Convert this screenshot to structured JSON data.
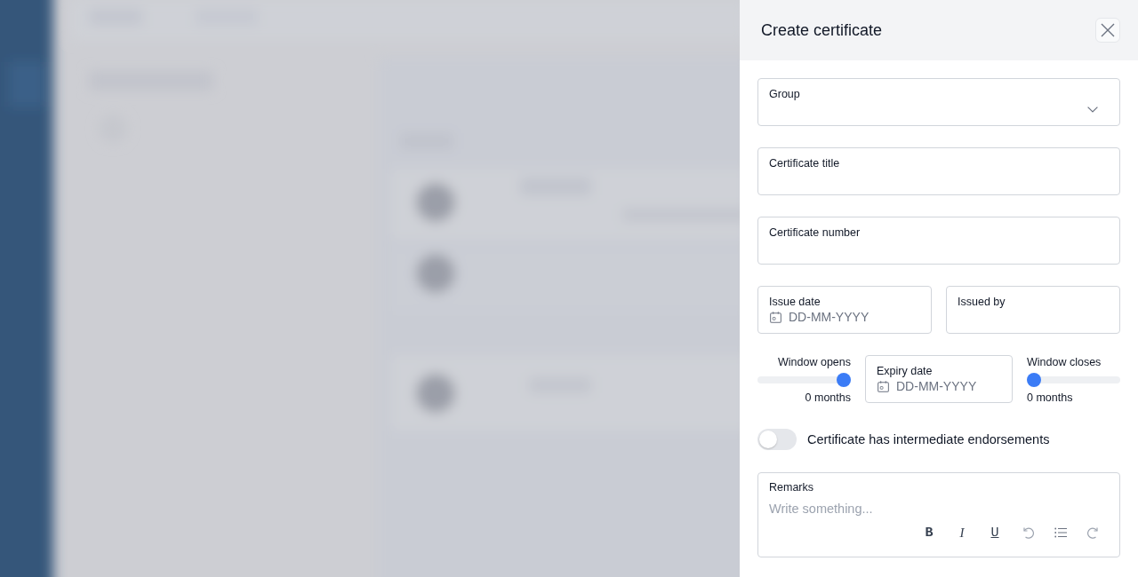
{
  "drawer": {
    "title": "Create certificate"
  },
  "fields": [
    {
      "kind": "select",
      "label": "Group"
    },
    {
      "kind": "text",
      "label": "Certificate title"
    },
    {
      "kind": "text",
      "label": "Certificate number"
    }
  ],
  "issue_row": [
    {
      "kind": "date",
      "label": "Issue date",
      "placeholder": "DD-MM-YYYY"
    },
    {
      "kind": "text",
      "label": "Issued by"
    }
  ],
  "window_row": {
    "opens": {
      "label": "Window opens",
      "level": 1,
      "reading": "0 months"
    },
    "expiry": {
      "kind": "date",
      "label": "Expiry date",
      "placeholder": "DD-MM-YYYY"
    },
    "closes": {
      "label": "Window closes",
      "level": 0,
      "reading": "0 months"
    }
  },
  "toggle": {
    "label": "Certificate has intermediate endorsements",
    "on": false
  },
  "remarks": {
    "label": "Remarks",
    "placeholder": "Write something...",
    "toolbar": [
      {
        "kind": "bold",
        "label": "B"
      },
      {
        "kind": "italic",
        "label": "I"
      },
      {
        "kind": "underline",
        "label": "U"
      },
      {
        "kind": "undo"
      },
      {
        "kind": "list"
      },
      {
        "kind": "redo"
      }
    ]
  }
}
